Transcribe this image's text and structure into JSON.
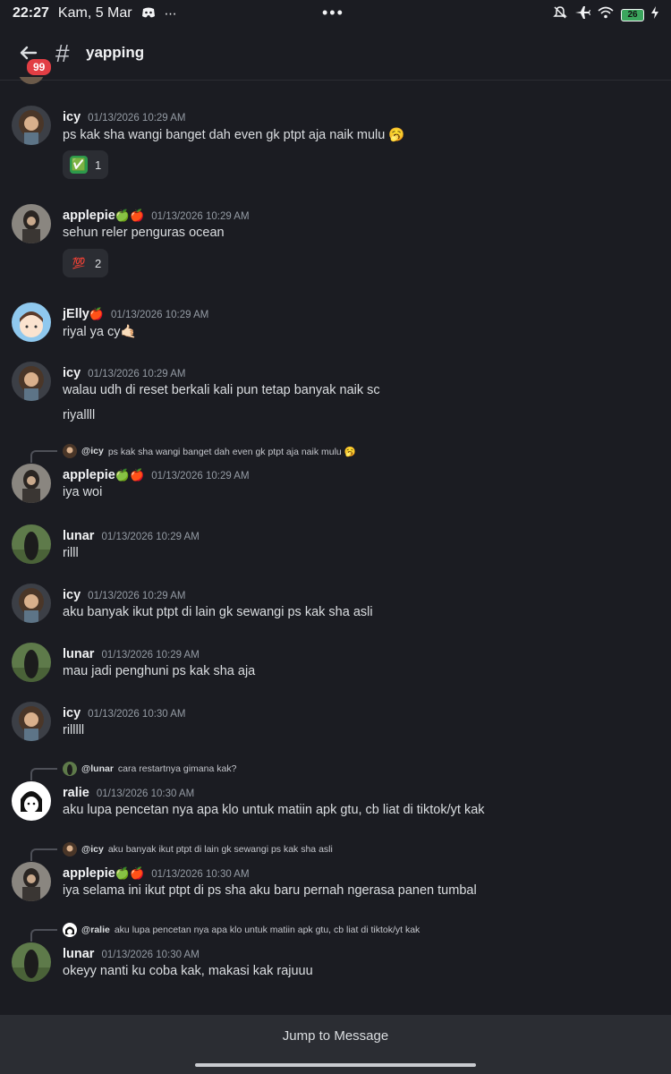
{
  "status": {
    "time": "22:27",
    "date": "Kam, 5 Mar",
    "battery": "26"
  },
  "header": {
    "badge": "99",
    "channel": "yapping"
  },
  "messages": [
    {
      "name": "icy",
      "ts": "01/13/2026 10:29 AM",
      "lines": [
        "ps kak sha wangi banget dah even gk ptpt aja naik mulu 🥱"
      ],
      "reaction": {
        "emoji": "✅",
        "count": "1"
      }
    },
    {
      "name": "applepie",
      "name_emoji": "🍏🍎",
      "ts": "01/13/2026 10:29 AM",
      "lines": [
        "sehun reler penguras ocean"
      ],
      "reaction": {
        "emoji": "💯",
        "count": "2"
      }
    },
    {
      "name": "jElly",
      "name_emoji": "🍎",
      "ts": "01/13/2026 10:29 AM",
      "lines": [
        "riyal ya cy🤙🏻"
      ]
    },
    {
      "name": "icy",
      "ts": "01/13/2026 10:29 AM",
      "lines": [
        "walau udh di reset berkali kali pun tetap banyak naik sc",
        "riyallll"
      ]
    },
    {
      "reply_to": "@icy",
      "reply_text": "ps kak sha wangi banget dah even gk ptpt aja naik mulu 🥱",
      "name": "applepie",
      "name_emoji": "🍏🍎",
      "ts": "01/13/2026 10:29 AM",
      "lines": [
        "iya woi"
      ]
    },
    {
      "name": "lunar",
      "ts": "01/13/2026 10:29 AM",
      "lines": [
        "rilll"
      ]
    },
    {
      "name": "icy",
      "ts": "01/13/2026 10:29 AM",
      "lines": [
        "aku banyak ikut ptpt di lain gk sewangi ps kak sha asli"
      ]
    },
    {
      "name": "lunar",
      "ts": "01/13/2026 10:29 AM",
      "lines": [
        "mau jadi penghuni ps kak sha aja"
      ]
    },
    {
      "name": "icy",
      "ts": "01/13/2026 10:30 AM",
      "lines": [
        "rilllll"
      ]
    },
    {
      "reply_to": "@lunar",
      "reply_text": "cara restartnya gimana kak?",
      "name": "ralie",
      "ts": "01/13/2026 10:30 AM",
      "lines": [
        "aku lupa pencetan nya apa klo untuk matiin apk gtu, cb liat di tiktok/yt kak"
      ]
    },
    {
      "reply_to": "@icy",
      "reply_text": "aku banyak ikut ptpt di lain gk sewangi ps kak sha asli",
      "name": "applepie",
      "name_emoji": "🍏🍎",
      "ts": "01/13/2026 10:30 AM",
      "lines": [
        "iya selama ini ikut ptpt di ps sha aku baru pernah ngerasa panen tumbal"
      ]
    },
    {
      "reply_to": "@ralie",
      "reply_text": "aku lupa pencetan nya apa klo untuk matiin apk gtu, cb liat di tiktok/yt kak",
      "name": "lunar",
      "ts": "01/13/2026 10:30 AM",
      "lines": [
        "okeyy nanti ku coba kak, makasi kak rajuuu"
      ]
    }
  ],
  "footer": {
    "jump_label": "Jump to Message"
  },
  "icons": [
    "back-arrow-icon",
    "hash-icon",
    "mute-icon",
    "airplane-icon",
    "wifi-icon",
    "battery-icon",
    "discord-icon"
  ]
}
